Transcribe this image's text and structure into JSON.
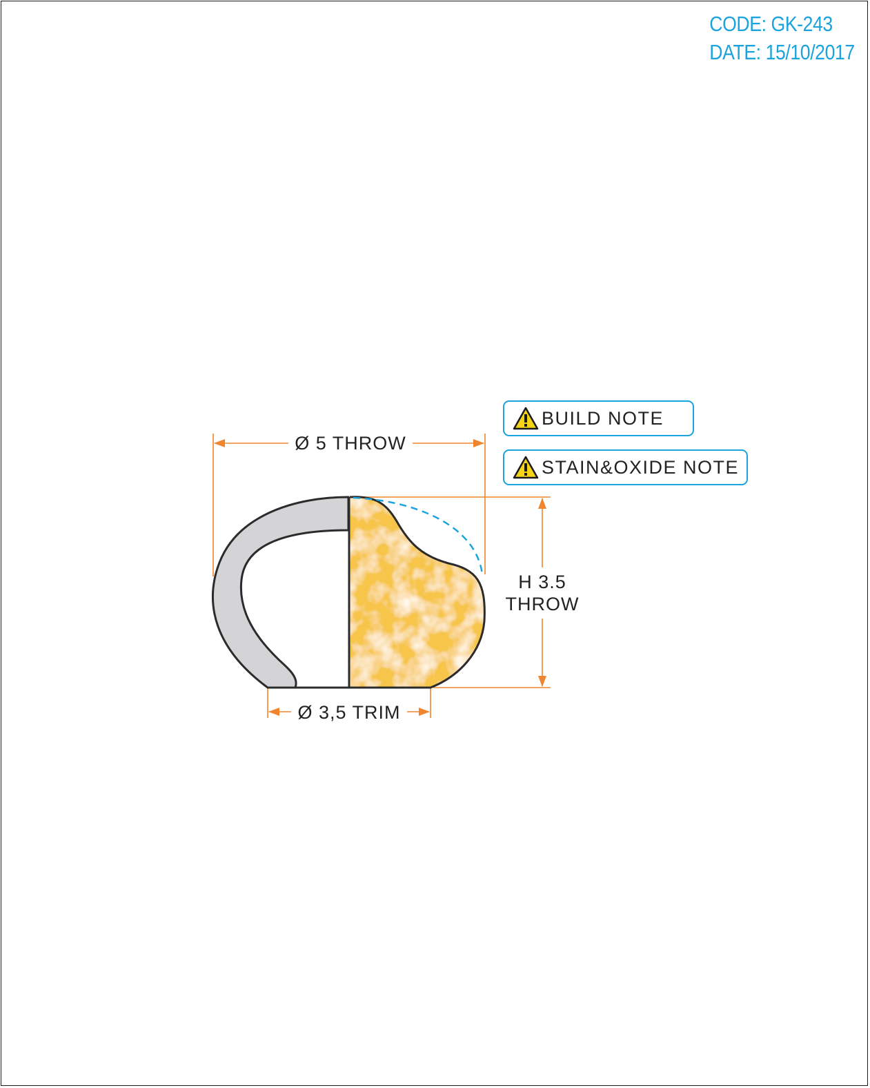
{
  "header": {
    "code": "CODE: GK-243",
    "date": "DATE: 15/10/2017"
  },
  "notes": [
    {
      "label": "BUILD NOTE",
      "icon": "warning-icon"
    },
    {
      "label": "STAIN&OXIDE NOTE",
      "icon": "warning-icon"
    }
  ],
  "dimensions": {
    "throw_diameter": "Ø 5 THROW",
    "height_line1": "H 3.5",
    "height_line2": "THROW",
    "trim_diameter": "Ø 3,5 TRIM"
  },
  "colors": {
    "accent_blue": "#1aa3dc",
    "dimension_orange": "#f0852d",
    "outline": "#2b2b2b",
    "shell_gray": "#d4d4d6",
    "stone_yellow": "#f7c548",
    "warning_yellow": "#f5d316"
  }
}
